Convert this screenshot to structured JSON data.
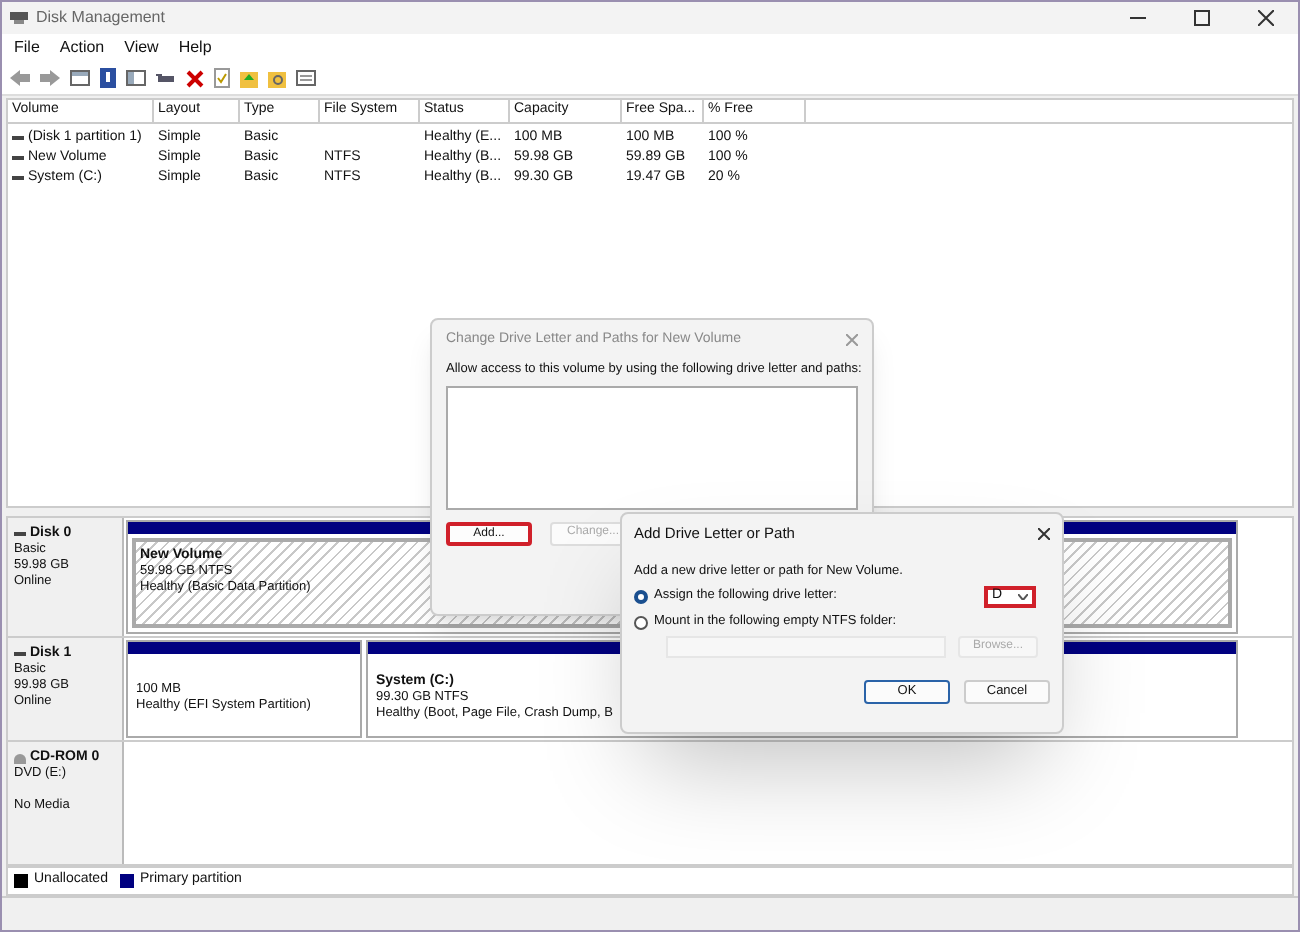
{
  "window": {
    "title": "Disk Management"
  },
  "menu": [
    "File",
    "Action",
    "View",
    "Help"
  ],
  "volumes": {
    "columns": [
      "Volume",
      "Layout",
      "Type",
      "File System",
      "Status",
      "Capacity",
      "Free Spa...",
      "% Free"
    ],
    "rows": [
      {
        "cells": [
          "(Disk 1 partition 1)",
          "Simple",
          "Basic",
          "",
          "Healthy (E...",
          "100 MB",
          "100 MB",
          "100 %"
        ]
      },
      {
        "cells": [
          "New Volume",
          "Simple",
          "Basic",
          "NTFS",
          "Healthy (B...",
          "59.98 GB",
          "59.89 GB",
          "100 %"
        ]
      },
      {
        "cells": [
          "System (C:)",
          "Simple",
          "Basic",
          "NTFS",
          "Healthy (B...",
          "99.30 GB",
          "19.47 GB",
          "20 %"
        ]
      }
    ]
  },
  "disks": [
    {
      "kind": "disk",
      "name": "Disk 0",
      "type": "Basic",
      "size": "59.98 GB",
      "status": "Online",
      "partitions": [
        {
          "title": "New Volume",
          "size": "59.98 GB NTFS",
          "status": "Healthy (Basic Data Partition)",
          "selected": true
        }
      ]
    },
    {
      "kind": "disk",
      "name": "Disk 1",
      "type": "Basic",
      "size": "99.98 GB",
      "status": "Online",
      "partitions": [
        {
          "size": "100 MB",
          "status": "Healthy (EFI System Partition)",
          "selected": false
        },
        {
          "title": "System  (C:)",
          "size": "99.30 GB NTFS",
          "status": "Healthy (Boot, Page File, Crash Dump, B",
          "selected": false
        }
      ]
    },
    {
      "kind": "cdrom",
      "name": "CD-ROM 0",
      "type": "DVD (E:)",
      "status": "No Media"
    }
  ],
  "legend": [
    {
      "label": "Unallocated",
      "color": "#000000"
    },
    {
      "label": "Primary partition",
      "color": "#000080"
    }
  ],
  "change_dialog": {
    "title": "Change Drive Letter and Paths for New Volume",
    "message": "Allow access to this volume by using the following drive letter and paths:",
    "buttons": [
      {
        "label": "Add...",
        "disabled": false,
        "highlighted": true
      },
      {
        "label": "Change...",
        "disabled": true,
        "highlighted": false
      }
    ]
  },
  "add_dialog": {
    "title": "Add Drive Letter or Path",
    "message": "Add a new drive letter or path for New Volume.",
    "options": [
      {
        "label": "Assign the following drive letter:",
        "selected": true
      },
      {
        "label": "Mount in the following empty NTFS folder:",
        "selected": false
      }
    ],
    "drive_letter": {
      "value": "D",
      "highlighted": true
    },
    "browse": {
      "label": "Browse...",
      "disabled": true
    },
    "buttons": [
      {
        "label": "OK",
        "default": true
      },
      {
        "label": "Cancel",
        "default": false
      }
    ]
  }
}
